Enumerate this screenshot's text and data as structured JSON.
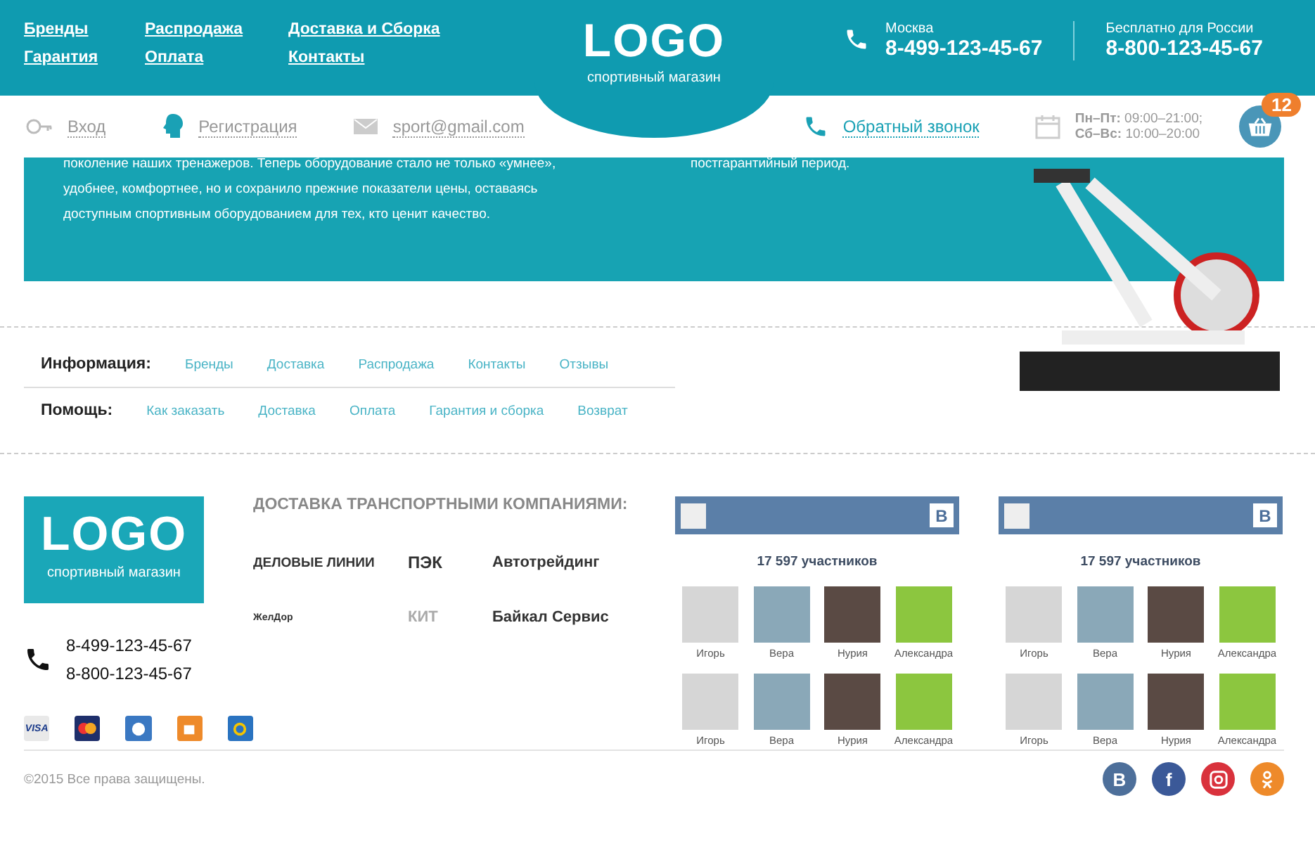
{
  "header": {
    "nav": [
      "Бренды",
      "Распродажа",
      "Доставка и Сборка",
      "Гарантия",
      "Оплата",
      "Контакты"
    ],
    "logo": {
      "title": "LOGO",
      "subtitle": "спортивный магазин"
    },
    "phones": [
      {
        "city": "Москва",
        "number": "8-499-123-45-67"
      },
      {
        "city": "Бесплатно для России",
        "number": "8-800-123-45-67"
      }
    ]
  },
  "subbar": {
    "login": "Вход",
    "register": "Регистрация",
    "email": "sport@gmail.com",
    "callback": "Обратный звонок",
    "hours": [
      "**Пн–Пт:** 09:00–21:00;",
      "**Сб–Вс:** 10:00–20:00"
    ],
    "cart_count": "12"
  },
  "banner": {
    "text_left": "поколение наших тренажеров. Теперь оборудование стало не только «умнее», удобнее, комфортнее, но и сохранило прежние показатели цены, оставаясь доступным спортивным оборудованием для тех, кто ценит качество.",
    "text_right": "постгарантийный период."
  },
  "info_rows": [
    {
      "label": "Информация:",
      "links": [
        "Бренды",
        "Доставка",
        "Распродажа",
        "Контакты",
        "Отзывы"
      ]
    },
    {
      "label": "Помощь:",
      "links": [
        "Как заказать",
        "Доставка",
        "Оплата",
        "Гарантия и сборка",
        "Возврат"
      ]
    }
  ],
  "footer": {
    "logo": {
      "title": "LOGO",
      "subtitle": "спортивный магазин"
    },
    "phones": [
      "8-499-123-45-67",
      "8-800-123-45-67"
    ],
    "payments": [
      {
        "kind": "visa",
        "label": "VISA"
      },
      {
        "kind": "card"
      },
      {
        "kind": "globe"
      },
      {
        "kind": "wallet"
      },
      {
        "kind": "ring"
      }
    ],
    "delivery_title": "ДОСТАВКА ТРАНСПОРТНЫМИ КОМПАНИЯМИ:",
    "carriers": [
      "ДЕЛОВЫЕ ЛИНИИ",
      "ПЭК",
      "Автотрейдинг",
      "ЖелДор",
      "КИТ",
      "Байкал Сервис"
    ],
    "widgets": [
      {
        "badge": "B",
        "members": "17 597 участников",
        "people": [
          "Игорь",
          "Вера",
          "Нурия",
          "Александра",
          "Игорь",
          "Вера",
          "Нурия",
          "Александра"
        ]
      },
      {
        "badge": "B",
        "members": "17 597 участников",
        "people": [
          "Игорь",
          "Вера",
          "Нурия",
          "Александра",
          "Игорь",
          "Вера",
          "Нурия",
          "Александра"
        ]
      }
    ],
    "copyright": "©2015 Все права защищены.",
    "socials": [
      {
        "kind": "letter",
        "label": "B",
        "color": "#4d6f9a"
      },
      {
        "kind": "letter",
        "label": "f",
        "color": "#3b5998"
      },
      {
        "kind": "camera",
        "color": "#d9323c"
      },
      {
        "kind": "person",
        "color": "#ee8a2a"
      }
    ]
  }
}
